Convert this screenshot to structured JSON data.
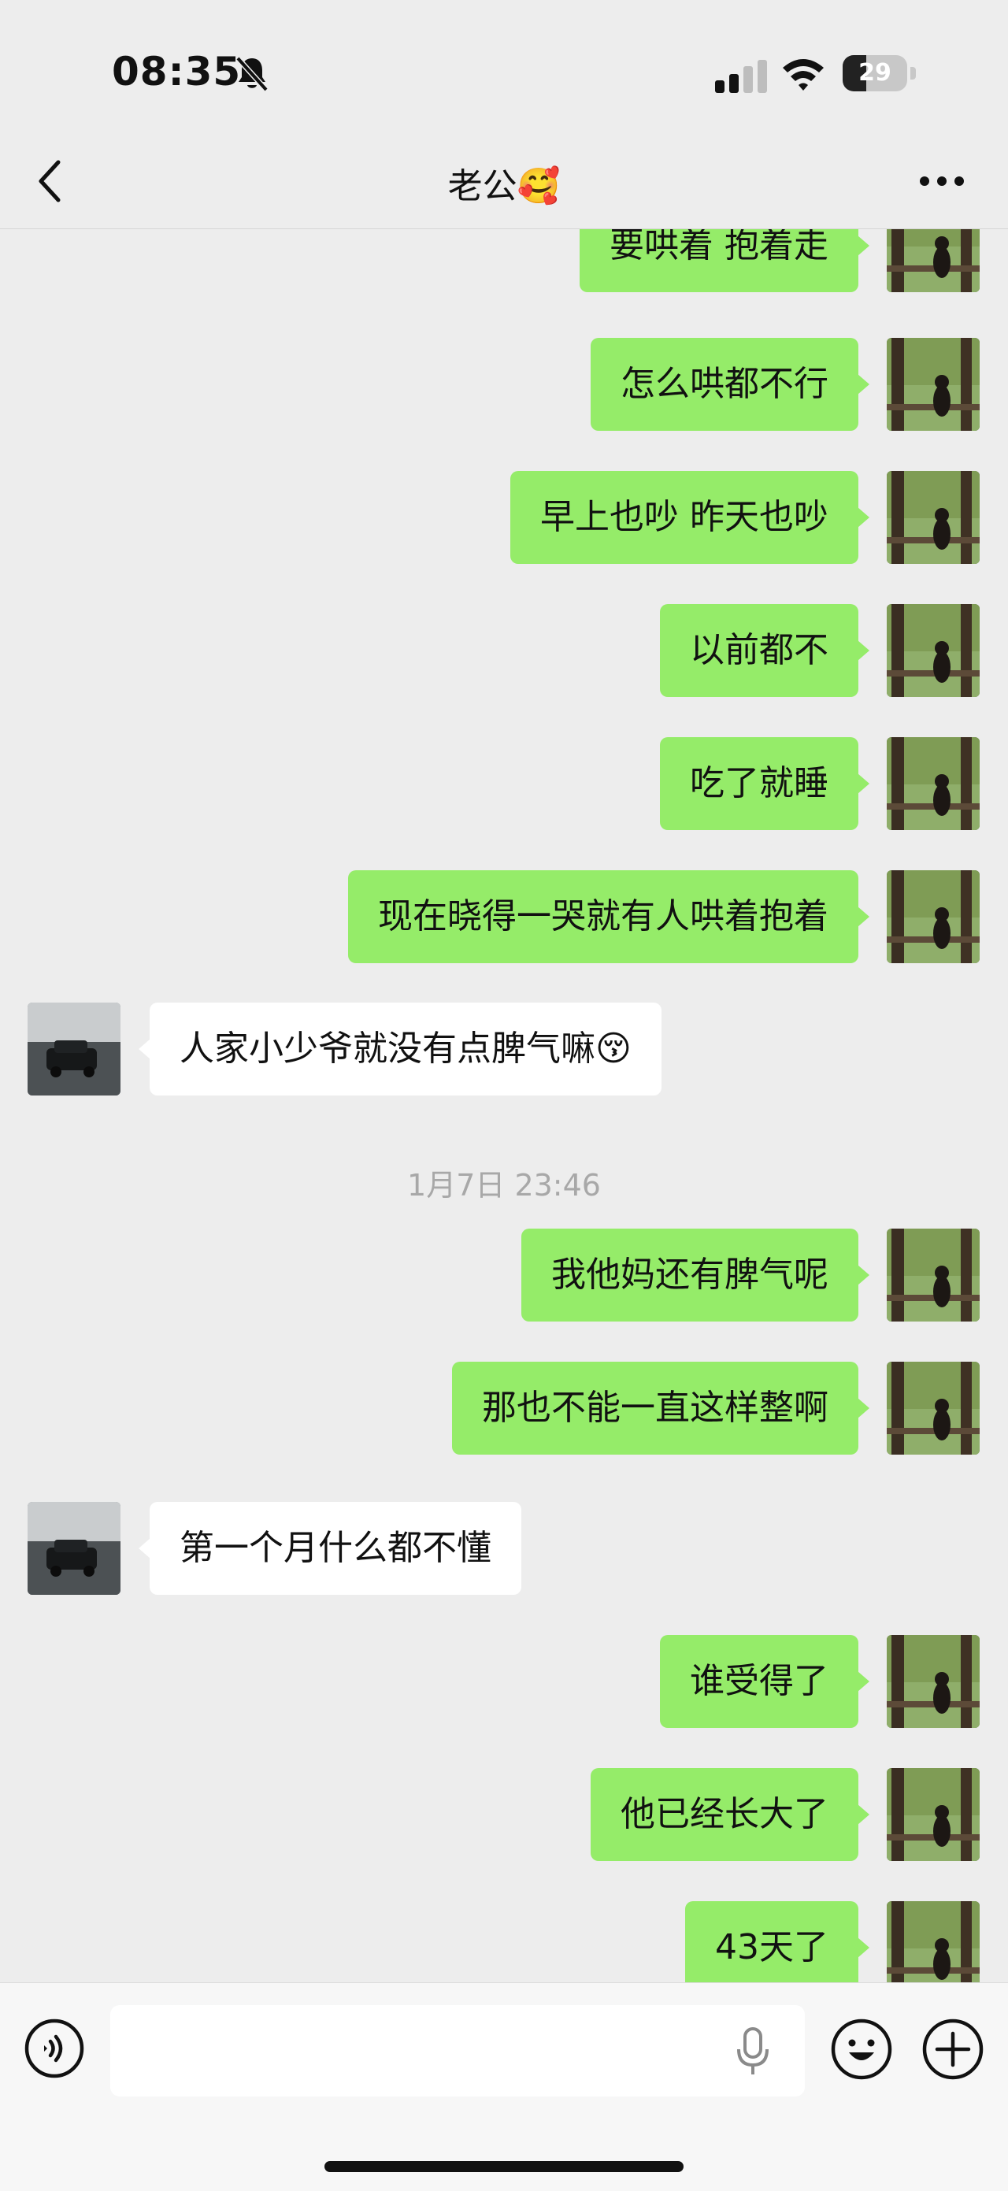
{
  "status_bar": {
    "time": "08:35",
    "battery": "29"
  },
  "header": {
    "title": "老公🥰"
  },
  "messages": [
    {
      "side": "me",
      "text": "要哄着 抱着走"
    },
    {
      "side": "me",
      "text": "怎么哄都不行"
    },
    {
      "side": "me",
      "text": "早上也吵 昨天也吵"
    },
    {
      "side": "me",
      "text": "以前都不"
    },
    {
      "side": "me",
      "text": "吃了就睡"
    },
    {
      "side": "me",
      "text": "现在晓得一哭就有人哄着抱着"
    },
    {
      "side": "other",
      "text": "人家小少爷就没有点脾气嘛😚"
    },
    {
      "side": "me",
      "text": "我他妈还有脾气呢"
    },
    {
      "side": "me",
      "text": "那也不能一直这样整啊"
    },
    {
      "side": "other",
      "text": "第一个月什么都不懂"
    },
    {
      "side": "me",
      "text": "谁受得了"
    },
    {
      "side": "me",
      "text": "他已经长大了"
    },
    {
      "side": "me",
      "text": "43天了"
    }
  ],
  "timestamp": "1月7日 23:46",
  "input": {
    "value": "",
    "placeholder": ""
  },
  "icons": {
    "back": "chevron-left-icon",
    "more": "more-dots-icon",
    "voice": "voice-icon",
    "mic": "mic-icon",
    "emoji": "emoji-icon",
    "plus": "plus-icon"
  },
  "colors": {
    "my_bubble": "#95ec69",
    "their_bubble": "#ffffff",
    "background": "#ededed"
  }
}
